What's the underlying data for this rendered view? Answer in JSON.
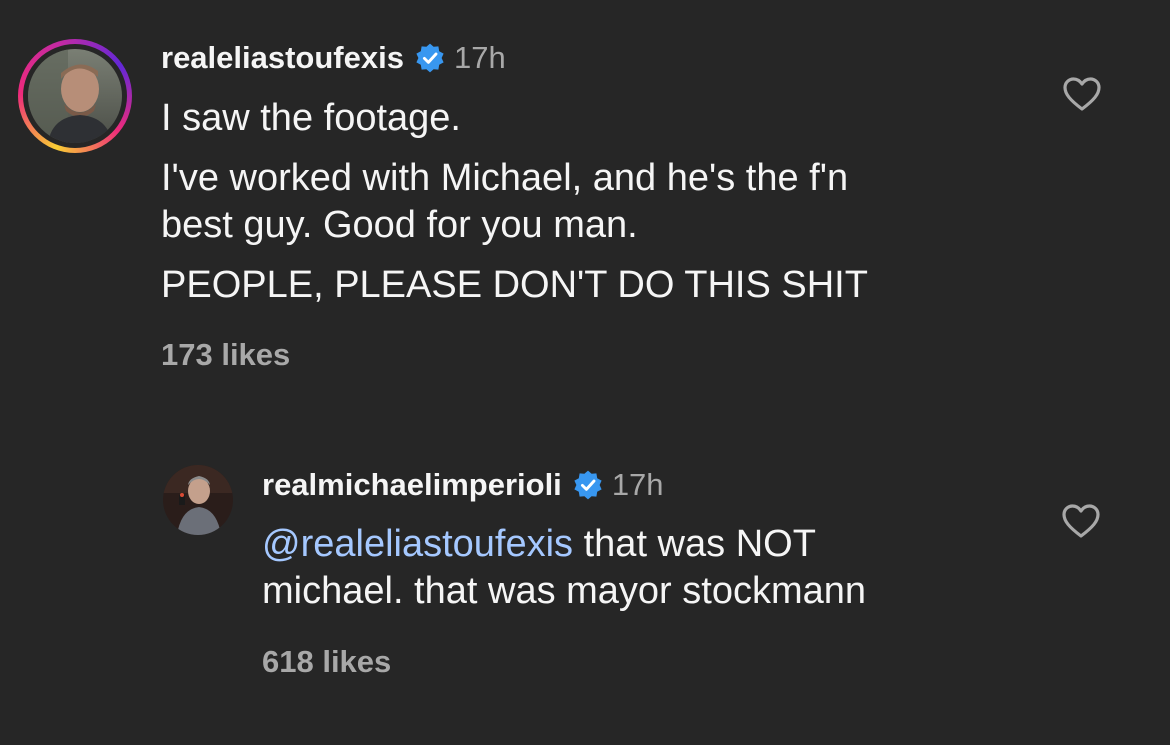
{
  "comments": [
    {
      "username": "realeliastoufexis",
      "time": "17h",
      "lines": [
        "I saw the footage.",
        "I've worked with Michael, and he's the f'n",
        "best guy. Good for you man.",
        "PEOPLE, PLEASE DON'T DO THIS SHIT"
      ],
      "likes": "173 likes"
    },
    {
      "username": "realmichaelimperioli",
      "time": "17h",
      "mention": "@realeliastoufexis",
      "line1_rest": " that was NOT",
      "line2": "michael. that was mayor stockmann",
      "likes": "618 likes"
    }
  ],
  "colors": {
    "background": "#262626",
    "text": "#f5f5f5",
    "secondary": "#a8a8a8",
    "mention": "#a5c8ff",
    "verified": "#3897f0"
  },
  "icons": [
    "verified-badge-icon",
    "heart-icon"
  ]
}
